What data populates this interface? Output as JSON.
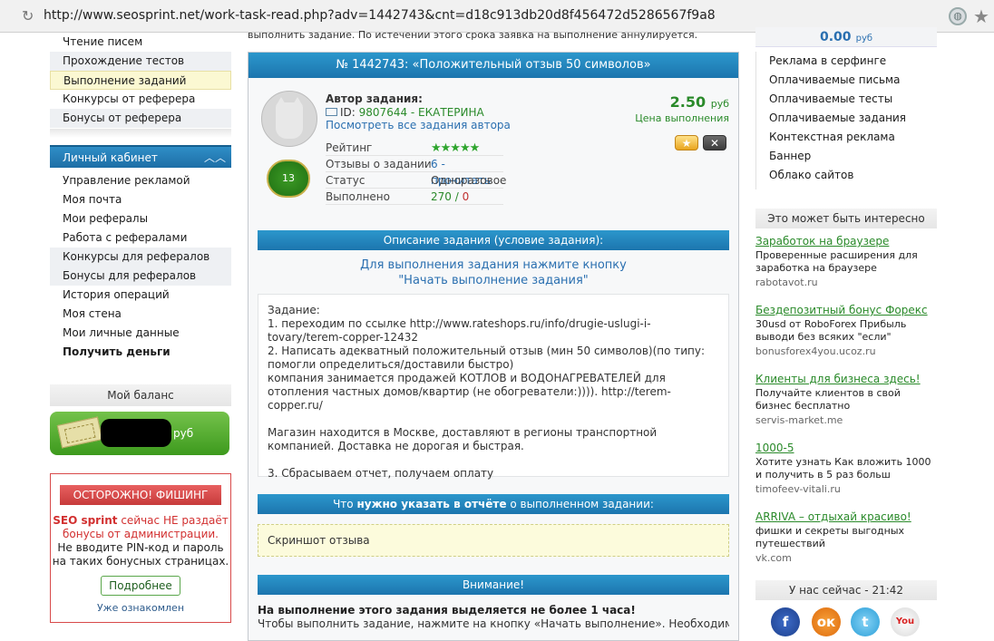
{
  "browser": {
    "url": "http://www.seosprint.net/work-task-read.php?adv=1442743&cnt=d18c913db20d8f456472d5286567f9a8"
  },
  "left_menu": {
    "items": [
      {
        "label": "Чтение писем"
      },
      {
        "label": "Прохождение тестов"
      },
      {
        "label": "Выполнение заданий"
      },
      {
        "label": "Конкурсы от реферера"
      },
      {
        "label": "Бонусы от реферера"
      }
    ]
  },
  "cabinet": {
    "title": "Личный кабинет",
    "items": [
      {
        "label": "Управление рекламой"
      },
      {
        "label": "Моя почта"
      },
      {
        "label": "Мои рефералы"
      },
      {
        "label": "Работа с рефералами"
      },
      {
        "label": "Конкурсы для рефералов"
      },
      {
        "label": "Бонусы для рефералов"
      },
      {
        "label": "История операций"
      },
      {
        "label": "Моя стена"
      },
      {
        "label": "Мои личные данные"
      },
      {
        "label": "Получить деньги"
      }
    ]
  },
  "balance": {
    "title": "Мой баланс",
    "currency": "руб"
  },
  "phishing": {
    "title": "ОСТОРОЖНО! ФИШИНГ",
    "brand": "SEO sprint",
    "line1": " сейчас НЕ раздаёт бонусы от администрации.",
    "line2": "Не вводите PIN-код и пароль на таких бонусных страницах.",
    "button": "Подробнее",
    "ack": "Уже ознакомлен"
  },
  "task": {
    "top_note": "выполнить задание. По истечении этого срока заявка на выполнение аннулируется.",
    "title": "№ 1442743: «Положительный отзыв 50 символов»",
    "author_label": "Автор задания:",
    "author_id_prefix": "ID:",
    "author_id": "9807644 - ЕКАТЕРИНА",
    "author_link": "Посмотреть все задания автора",
    "level": "13",
    "price": "2.50",
    "price_currency": "руб",
    "price_label": "Цена выполнения",
    "stats": [
      {
        "key": "Рейтинг",
        "value": "★★★★★"
      },
      {
        "key": "Отзывы о задании",
        "value": "6 - прочитать"
      },
      {
        "key": "Статус",
        "value": "Одноразовое"
      },
      {
        "key": "Выполнено",
        "value_done": "270",
        "value_sep": " / ",
        "value_fail": "0"
      }
    ],
    "desc_header": "Описание задания (условие задания):",
    "instruction_line1": "Для выполнения задания нажмите кнопку",
    "instruction_line2": "\"Начать выполнение задания\"",
    "desc_lines": [
      "Задание:",
      "1. переходим по ссылке http://www.rateshops.ru/info/drugie-uslugi-i-tovary/terem-copper-12432",
      "2. Написать адекватный положительный отзыв (мин 50 символов)(по типу: помогли определиться/доставили быстро)",
      "компания занимается продажей КОТЛОВ и ВОДОНАГРЕВАТЕЛЕЙ для отопления частных домов/квартир (не обогреватели:)))). http://terem-copper.ru/",
      "",
      "Магазин находится в Москве, доставляют в регионы транспортной компанией. Доставка не дорогая и быстрая.",
      "",
      "3. Сбрасываем отчет, получаем оплату"
    ],
    "report_header_pre": "Что ",
    "report_header_bold": "нужно указать в отчёте",
    "report_header_post": " о выполненном задании:",
    "report_text": "Скриншот отзыва",
    "attention_header": "Внимание!",
    "attention_title": "На выполнение этого задания выделяется не более 1 часа!",
    "attention_text": "Чтобы выполнить задание, нажмите на кнопку «Начать выполнение». Необходимую"
  },
  "right": {
    "balance_value": "0.00",
    "balance_currency": "руб",
    "menu": [
      {
        "label": "Реклама в серфинге"
      },
      {
        "label": "Оплачиваемые письма"
      },
      {
        "label": "Оплачиваемые тесты"
      },
      {
        "label": "Оплачиваемые задания"
      },
      {
        "label": "Контекстная реклама"
      },
      {
        "label": "Баннер"
      },
      {
        "label": "Облако сайтов"
      }
    ],
    "interesting_title": "Это может быть интересно",
    "ads": [
      {
        "title": "Заработок на браузере",
        "text": "Проверенные расширения для заработка на браузере",
        "url": "rabotavot.ru"
      },
      {
        "title": "Бездепозитный бонус Форекс",
        "text": "30usd от RoboForex Прибыль выводи без всяких \"если\"",
        "url": "bonusforex4you.ucoz.ru"
      },
      {
        "title": "Клиенты для бизнеса здесь!",
        "text": "Получайте клиентов в свой бизнес бесплатно",
        "url": "servis-market.me"
      },
      {
        "title": "1000-5",
        "text": "Хотите узнать Как вложить 1000 и получить в 5 раз больш",
        "url": "timofeev-vitali.ru"
      },
      {
        "title": "ARRIVA – отдыхай красиво!",
        "text": "фишки и секреты выгодных путешествий",
        "url": "vk.com"
      }
    ],
    "now_title": "У нас сейчас - 21:42",
    "social": {
      "fb": "f",
      "ok": "ок",
      "tw": "t",
      "yt": "You"
    }
  },
  "colors": {
    "accent_blue": "#1d75ae",
    "link_green": "#2a8a2a",
    "warning_red": "#d23030"
  }
}
